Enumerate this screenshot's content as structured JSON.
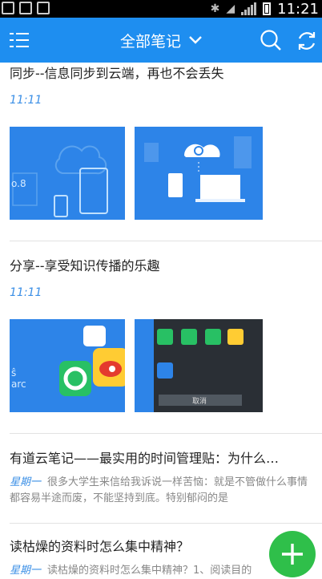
{
  "status": {
    "time": "11:21"
  },
  "header": {
    "title": "全部笔记"
  },
  "notes": [
    {
      "title": "同步--信息同步到云端，再也不会丢失",
      "time": "11:11"
    },
    {
      "title": "分享--享受知识传播的乐趣",
      "time": "11:11"
    },
    {
      "title": "有道云笔记——最实用的时间管理贴：为什么…",
      "time": "星期一",
      "excerpt": "很多大学生来信给我诉说一样苦恼：就是不管做什么事情都容易半途而废，不能坚持到底。特别郁闷的是"
    },
    {
      "title": "读枯燥的资料时怎么集中精神？",
      "time": "星期一",
      "excerpt": "读枯燥的资料时怎么集中精神？1、阅读目的"
    }
  ],
  "thumbs": {
    "sync_left_text": "o.8",
    "share_right_button": "取消"
  },
  "colors": {
    "accent": "#1e8ef0",
    "fab": "#2fbf4a",
    "time": "#3b8fe6"
  }
}
